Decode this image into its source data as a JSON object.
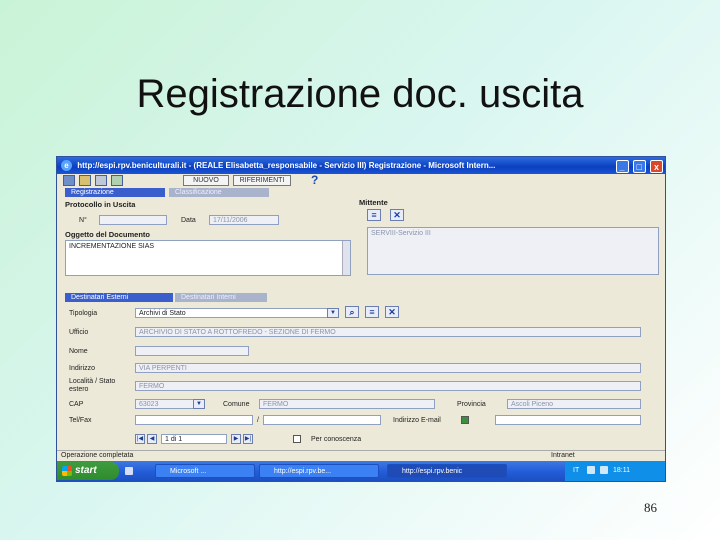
{
  "slide": {
    "title": "Registrazione doc. uscita",
    "page_number": "86"
  },
  "window": {
    "title": "http://espi.rpv.beniculturali.it - (REALE Elisabetta_responsabile - Servizio III) Registrazione - Microsoft Intern...",
    "buttons": [
      "_",
      "□",
      "x"
    ]
  },
  "toolbar": {
    "btn_nuovo": "NUOVO",
    "btn_riferimenti": "RIFERIMENTI",
    "help": "?"
  },
  "top_tabs": [
    "Registrazione",
    "Classificazione"
  ],
  "protocollo": {
    "heading": "Protocollo in Uscita",
    "n_label": "N°",
    "data_label": "Data",
    "data_value": "17/11/2006"
  },
  "oggetto": {
    "heading": "Oggetto del Documento",
    "value": "INCREMENTAZIONE SIAS"
  },
  "mittente": {
    "heading": "Mittente",
    "value": "SERVIII-Servizio III"
  },
  "dest_tabs": [
    "Destinatari Esterni",
    "Destinatari Interni"
  ],
  "form": {
    "tipologia_label": "Tipologia",
    "tipologia_value": "Archivi di Stato",
    "ufficio_label": "Ufficio",
    "ufficio_value": "ARCHIVIO DI STATO A ROTTOFREDO - SEZIONE DI FERMO",
    "nome_label": "Nome",
    "indirizzo_label": "Indirizzo",
    "indirizzo_value": "VIA PERPENTI",
    "localita_label": "Località / Stato estero",
    "localita_value": "FERMO",
    "cap_label": "CAP",
    "cap_value": "63023",
    "comune_label": "Comune",
    "comune_value": "FERMO",
    "provincia_label": "Provincia",
    "provincia_value": "Ascoli Piceno",
    "telfax_label": "Tel/Fax",
    "telfax_sep": "/",
    "email_label": "Indirizzo E-mail",
    "nav_value": "1 di 1",
    "conoscenza_label": "Per conoscenza"
  },
  "statusbar": {
    "text": "Operazione completata",
    "zone": "Intranet"
  },
  "taskbar": {
    "start": "start",
    "tasks": [
      "Microsoft ... ",
      "http://espi.rpv.be...",
      "http://espi.rpv.benic"
    ],
    "tray_lang": "IT",
    "clock": "18:11"
  }
}
